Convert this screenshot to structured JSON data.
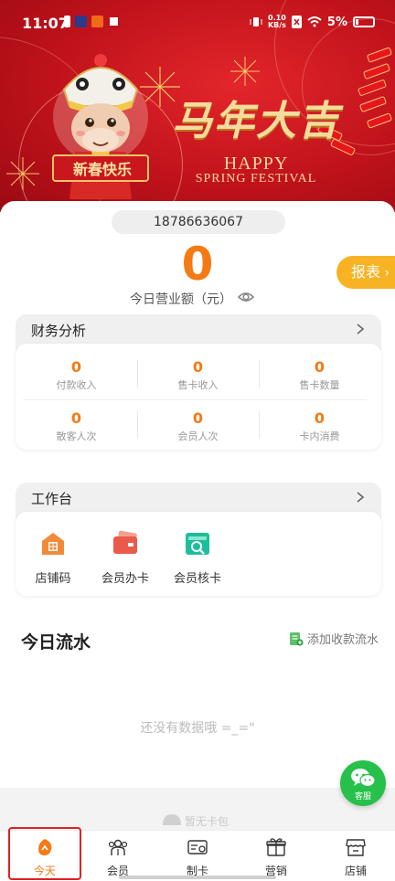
{
  "status_bar": {
    "time": "11:07",
    "net_speed_value": "0.10",
    "net_speed_unit": "KB/s",
    "battery": "5%"
  },
  "banner": {
    "title": "马年大吉",
    "happy": "HAPPY",
    "spring": "SPRING FESTIVAL",
    "mascot_sign": "新春快乐"
  },
  "account": {
    "phone": "18786636067"
  },
  "revenue": {
    "amount": "0",
    "label": "今日营业额（元）"
  },
  "report_button": "报表",
  "finance": {
    "title": "财务分析",
    "cells": [
      {
        "value": "0",
        "label": "付款收入"
      },
      {
        "value": "0",
        "label": "售卡收入"
      },
      {
        "value": "0",
        "label": "售卡数量"
      },
      {
        "value": "0",
        "label": "散客人次"
      },
      {
        "value": "0",
        "label": "会员人次"
      },
      {
        "value": "0",
        "label": "卡内消费"
      }
    ]
  },
  "workbench": {
    "title": "工作台",
    "items": [
      {
        "label": "店铺码",
        "icon": "store-code-icon"
      },
      {
        "label": "会员办卡",
        "icon": "member-card-icon"
      },
      {
        "label": "会员核卡",
        "icon": "verify-card-icon"
      }
    ]
  },
  "flow": {
    "title": "今日流水",
    "add_label": "添加收款流水",
    "empty": "还没有数据哦 =_=\""
  },
  "service": {
    "label": "客服"
  },
  "bottom_strip_text": "暂无卡包",
  "tabs": [
    {
      "label": "今天",
      "icon": "today-icon",
      "active": true
    },
    {
      "label": "会员",
      "icon": "members-icon",
      "active": false
    },
    {
      "label": "制卡",
      "icon": "make-card-icon",
      "active": false
    },
    {
      "label": "营销",
      "icon": "gift-icon",
      "active": false
    },
    {
      "label": "店铺",
      "icon": "shop-icon",
      "active": false
    }
  ],
  "colors": {
    "accent": "#f47a14",
    "banner_red": "#c0121b",
    "report_button": "#f8b325",
    "wechat_green": "#27c04b",
    "active_outline": "#e02020"
  }
}
